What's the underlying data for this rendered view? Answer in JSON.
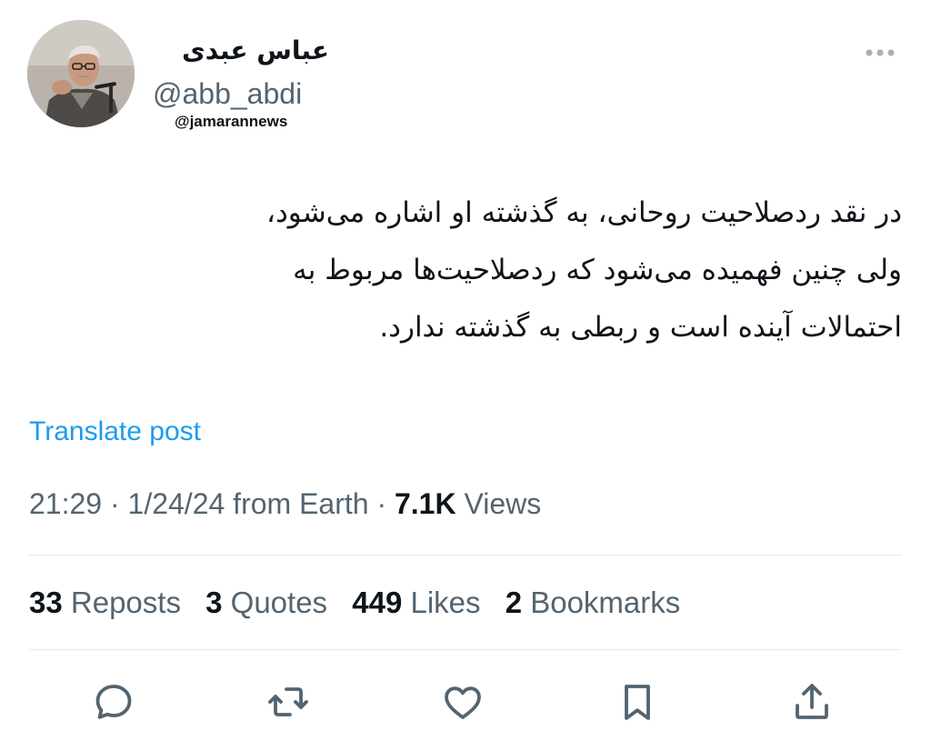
{
  "author": {
    "display_name": "عباس عبدی",
    "handle": "@abb_abdi"
  },
  "watermark": "@jamarannews",
  "tweet": {
    "lines": [
      "در نقد ردصلاحیت روحانی، به گذشته او اشاره می‌شود،",
      "ولی چنین فهمیده می‌شود که ردصلاحیت‌ها مربوط به",
      "احتمالات آینده است و ربطی به گذشته ندارد."
    ]
  },
  "translate_label": "Translate post",
  "meta": {
    "time": "21:29",
    "date": "1/24/24",
    "source": "from Earth",
    "views_count": "7.1K",
    "views_label": "Views"
  },
  "stats": [
    {
      "count": "33",
      "label": "Reposts"
    },
    {
      "count": "3",
      "label": "Quotes"
    },
    {
      "count": "449",
      "label": "Likes"
    },
    {
      "count": "2",
      "label": "Bookmarks"
    }
  ],
  "actions": {
    "reply_icon": "reply-icon",
    "repost_icon": "repost-icon",
    "like_icon": "like-icon",
    "bookmark_icon": "bookmark-icon",
    "share_icon": "share-icon"
  },
  "colors": {
    "link": "#1d9bf0",
    "secondary_text": "#536471",
    "primary_text": "#0f1419",
    "divider": "#e6e9ec"
  }
}
